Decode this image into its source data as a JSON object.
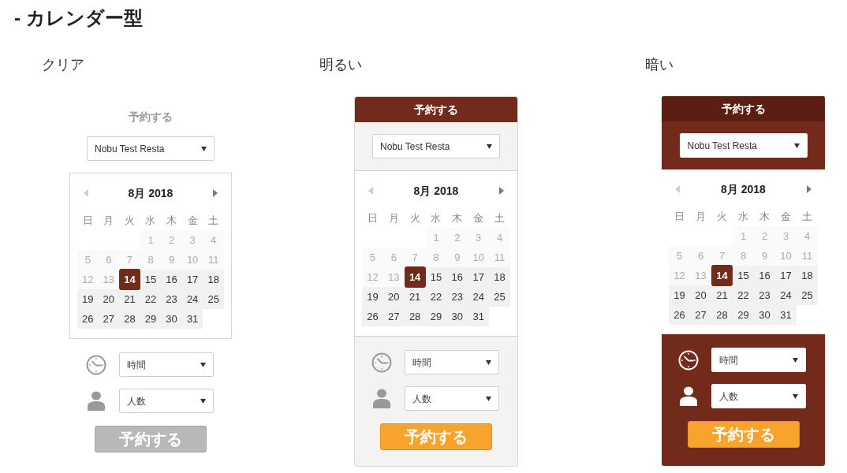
{
  "heading": "- カレンダー型",
  "widgets": [
    {
      "kind": "clear",
      "label": "クリア",
      "title": "予約する",
      "restaurant": {
        "value": "Nobu Test Resta"
      },
      "calendar": {
        "month": "8月 2018",
        "prev": {
          "disabled": true
        },
        "next": {
          "disabled": false
        },
        "weekdays": [
          "日",
          "月",
          "火",
          "水",
          "木",
          "金",
          "土"
        ],
        "weeks": [
          [
            {
              "day": "1",
              "disabled": true,
              "selected": false
            },
            {
              "day": "2",
              "disabled": true,
              "selected": false
            },
            {
              "day": "3",
              "disabled": true,
              "selected": false
            },
            {
              "day": "4",
              "disabled": true,
              "selected": false
            }
          ],
          [
            {
              "day": "5",
              "disabled": true,
              "selected": false
            },
            {
              "day": "6",
              "disabled": true,
              "selected": false
            },
            {
              "day": "7",
              "disabled": true,
              "selected": false
            },
            {
              "day": "8",
              "disabled": true,
              "selected": false
            },
            {
              "day": "9",
              "disabled": true,
              "selected": false
            },
            {
              "day": "10",
              "disabled": true,
              "selected": false
            },
            {
              "day": "11",
              "disabled": true,
              "selected": false
            }
          ],
          [
            {
              "day": "12",
              "disabled": true,
              "selected": false
            },
            {
              "day": "13",
              "disabled": true,
              "selected": false
            },
            {
              "day": "14",
              "disabled": false,
              "selected": true
            },
            {
              "day": "15",
              "disabled": false,
              "selected": false
            },
            {
              "day": "16",
              "disabled": false,
              "selected": false
            },
            {
              "day": "17",
              "disabled": false,
              "selected": false
            },
            {
              "day": "18",
              "disabled": false,
              "selected": false
            }
          ],
          [
            {
              "day": "19",
              "disabled": false,
              "selected": false
            },
            {
              "day": "20",
              "disabled": false,
              "selected": false
            },
            {
              "day": "21",
              "disabled": false,
              "selected": false
            },
            {
              "day": "22",
              "disabled": false,
              "selected": false
            },
            {
              "day": "23",
              "disabled": false,
              "selected": false
            },
            {
              "day": "24",
              "disabled": false,
              "selected": false
            },
            {
              "day": "25",
              "disabled": false,
              "selected": false
            }
          ],
          [
            {
              "day": "26",
              "disabled": false,
              "selected": false
            },
            {
              "day": "27",
              "disabled": false,
              "selected": false
            },
            {
              "day": "28",
              "disabled": false,
              "selected": false
            },
            {
              "day": "29",
              "disabled": false,
              "selected": false
            },
            {
              "day": "30",
              "disabled": false,
              "selected": false
            },
            {
              "day": "31",
              "disabled": false,
              "selected": false
            }
          ]
        ]
      },
      "time": {
        "placeholder": "時間"
      },
      "party": {
        "placeholder": "人数"
      },
      "submit": "予約する"
    },
    {
      "kind": "light",
      "label": "明るい",
      "title": "予約する",
      "restaurant": {
        "value": "Nobu Test Resta"
      },
      "calendar": {
        "month": "8月 2018",
        "prev": {
          "disabled": true
        },
        "next": {
          "disabled": false
        },
        "weekdays": [
          "日",
          "月",
          "火",
          "水",
          "木",
          "金",
          "土"
        ],
        "weeks": [
          [
            {
              "day": "1",
              "disabled": true,
              "selected": false
            },
            {
              "day": "2",
              "disabled": true,
              "selected": false
            },
            {
              "day": "3",
              "disabled": true,
              "selected": false
            },
            {
              "day": "4",
              "disabled": true,
              "selected": false
            }
          ],
          [
            {
              "day": "5",
              "disabled": true,
              "selected": false
            },
            {
              "day": "6",
              "disabled": true,
              "selected": false
            },
            {
              "day": "7",
              "disabled": true,
              "selected": false
            },
            {
              "day": "8",
              "disabled": true,
              "selected": false
            },
            {
              "day": "9",
              "disabled": true,
              "selected": false
            },
            {
              "day": "10",
              "disabled": true,
              "selected": false
            },
            {
              "day": "11",
              "disabled": true,
              "selected": false
            }
          ],
          [
            {
              "day": "12",
              "disabled": true,
              "selected": false
            },
            {
              "day": "13",
              "disabled": true,
              "selected": false
            },
            {
              "day": "14",
              "disabled": false,
              "selected": true
            },
            {
              "day": "15",
              "disabled": false,
              "selected": false
            },
            {
              "day": "16",
              "disabled": false,
              "selected": false
            },
            {
              "day": "17",
              "disabled": false,
              "selected": false
            },
            {
              "day": "18",
              "disabled": false,
              "selected": false
            }
          ],
          [
            {
              "day": "19",
              "disabled": false,
              "selected": false
            },
            {
              "day": "20",
              "disabled": false,
              "selected": false
            },
            {
              "day": "21",
              "disabled": false,
              "selected": false
            },
            {
              "day": "22",
              "disabled": false,
              "selected": false
            },
            {
              "day": "23",
              "disabled": false,
              "selected": false
            },
            {
              "day": "24",
              "disabled": false,
              "selected": false
            },
            {
              "day": "25",
              "disabled": false,
              "selected": false
            }
          ],
          [
            {
              "day": "26",
              "disabled": false,
              "selected": false
            },
            {
              "day": "27",
              "disabled": false,
              "selected": false
            },
            {
              "day": "28",
              "disabled": false,
              "selected": false
            },
            {
              "day": "29",
              "disabled": false,
              "selected": false
            },
            {
              "day": "30",
              "disabled": false,
              "selected": false
            },
            {
              "day": "31",
              "disabled": false,
              "selected": false
            }
          ]
        ]
      },
      "time": {
        "placeholder": "時間"
      },
      "party": {
        "placeholder": "人数"
      },
      "submit": "予約する"
    },
    {
      "kind": "dark",
      "label": "暗い",
      "title": "予約する",
      "restaurant": {
        "value": "Nobu Test Resta"
      },
      "calendar": {
        "month": "8月 2018",
        "prev": {
          "disabled": true
        },
        "next": {
          "disabled": false
        },
        "weekdays": [
          "日",
          "月",
          "火",
          "水",
          "木",
          "金",
          "土"
        ],
        "weeks": [
          [
            {
              "day": "1",
              "disabled": true,
              "selected": false
            },
            {
              "day": "2",
              "disabled": true,
              "selected": false
            },
            {
              "day": "3",
              "disabled": true,
              "selected": false
            },
            {
              "day": "4",
              "disabled": true,
              "selected": false
            }
          ],
          [
            {
              "day": "5",
              "disabled": true,
              "selected": false
            },
            {
              "day": "6",
              "disabled": true,
              "selected": false
            },
            {
              "day": "7",
              "disabled": true,
              "selected": false
            },
            {
              "day": "8",
              "disabled": true,
              "selected": false
            },
            {
              "day": "9",
              "disabled": true,
              "selected": false
            },
            {
              "day": "10",
              "disabled": true,
              "selected": false
            },
            {
              "day": "11",
              "disabled": true,
              "selected": false
            }
          ],
          [
            {
              "day": "12",
              "disabled": true,
              "selected": false
            },
            {
              "day": "13",
              "disabled": true,
              "selected": false
            },
            {
              "day": "14",
              "disabled": false,
              "selected": true
            },
            {
              "day": "15",
              "disabled": false,
              "selected": false
            },
            {
              "day": "16",
              "disabled": false,
              "selected": false
            },
            {
              "day": "17",
              "disabled": false,
              "selected": false
            },
            {
              "day": "18",
              "disabled": false,
              "selected": false
            }
          ],
          [
            {
              "day": "19",
              "disabled": false,
              "selected": false
            },
            {
              "day": "20",
              "disabled": false,
              "selected": false
            },
            {
              "day": "21",
              "disabled": false,
              "selected": false
            },
            {
              "day": "22",
              "disabled": false,
              "selected": false
            },
            {
              "day": "23",
              "disabled": false,
              "selected": false
            },
            {
              "day": "24",
              "disabled": false,
              "selected": false
            },
            {
              "day": "25",
              "disabled": false,
              "selected": false
            }
          ],
          [
            {
              "day": "26",
              "disabled": false,
              "selected": false
            },
            {
              "day": "27",
              "disabled": false,
              "selected": false
            },
            {
              "day": "28",
              "disabled": false,
              "selected": false
            },
            {
              "day": "29",
              "disabled": false,
              "selected": false
            },
            {
              "day": "30",
              "disabled": false,
              "selected": false
            },
            {
              "day": "31",
              "disabled": false,
              "selected": false
            }
          ]
        ]
      },
      "time": {
        "placeholder": "時間"
      },
      "party": {
        "placeholder": "人数"
      },
      "submit": "予約する"
    }
  ]
}
